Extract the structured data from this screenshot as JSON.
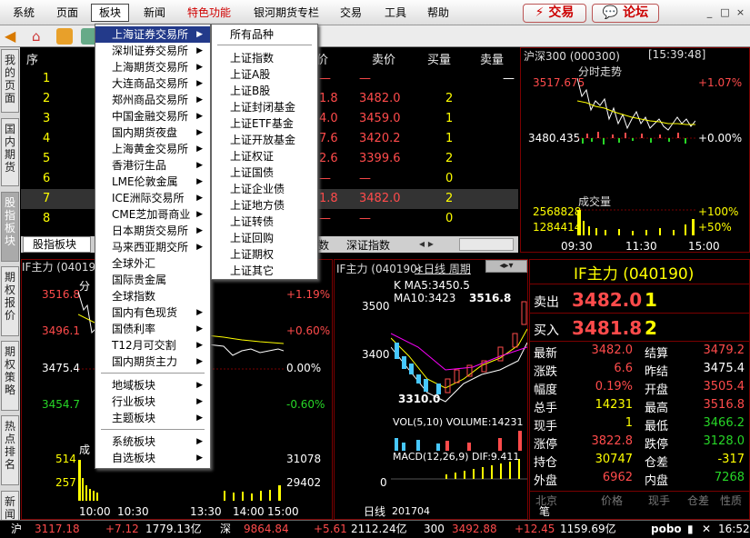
{
  "menubar": {
    "items": [
      "系统",
      "页面",
      "板块",
      "新闻",
      "特色功能",
      "银河期货专栏",
      "交易",
      "工具",
      "帮助"
    ],
    "trade": "交易",
    "forum": "论坛",
    "min": "_",
    "max": "□",
    "close": "×"
  },
  "sidebar": {
    "tabs": [
      "我的页面",
      "国内期货",
      "股指板块",
      "期权报价",
      "期权策略",
      "热点排名",
      "新闻"
    ]
  },
  "quote_table": {
    "headers": [
      "序",
      "价",
      "卖价",
      "买量",
      "卖量"
    ],
    "rows": [
      {
        "idx": "1",
        "price": "—",
        "ask": "—",
        "bidv": "",
        "askv": "—"
      },
      {
        "idx": "2",
        "price": "1.8",
        "ask": "3482.0",
        "bidv": "2",
        "askv": ""
      },
      {
        "idx": "3",
        "price": "4.0",
        "ask": "3459.0",
        "bidv": "1",
        "askv": ""
      },
      {
        "idx": "4",
        "price": "7.6",
        "ask": "3420.2",
        "bidv": "1",
        "askv": ""
      },
      {
        "idx": "5",
        "price": "2.6",
        "ask": "3399.6",
        "bidv": "2",
        "askv": ""
      },
      {
        "idx": "6",
        "price": "—",
        "ask": "—",
        "bidv": "0",
        "askv": ""
      },
      {
        "idx": "7",
        "price": "1.8",
        "ask": "3482.0",
        "bidv": "2",
        "askv": ""
      },
      {
        "idx": "8",
        "price": "—",
        "ask": "—",
        "bidv": "0",
        "askv": ""
      }
    ],
    "tab_active": "股指板块",
    "tab2": "数",
    "tab3": "深证指数"
  },
  "index_chart": {
    "title": "沪深300 (000300)",
    "time": "[15:39:48]",
    "label": "分时走势",
    "high": "3517.675",
    "mid": "3480.435",
    "pct_high": "+1.07%",
    "pct_mid": "+0.00%",
    "vol_label": "成交量",
    "vol_high": "2568828",
    "vol_mid": "1284414",
    "vol_pct_high": "+100%",
    "vol_pct_mid": "+50%",
    "times": [
      "09:30",
      "11:30",
      "15:00"
    ]
  },
  "if_left": {
    "title": "IF主力 (040190)",
    "p1": "3516.8",
    "p2": "3496.1",
    "p3": "3475.4",
    "p4": "3454.7",
    "pc1": "+1.19%",
    "pc2": "+0.60%",
    "pc3": "0.00%",
    "pc4": "-0.60%",
    "fen": "分",
    "cheng": "成",
    "v1": "514",
    "v2": "257",
    "v3": "31078",
    "v4": "29402",
    "times": [
      "10:00",
      "10:30",
      "13:30",
      "14:00",
      "15:00"
    ]
  },
  "if_kline": {
    "title": "IF主力 (040190)",
    "period": "<日线 周期",
    "ma": "K  MA5:3450.5  MA10:3423",
    "high": "3516.8",
    "low": "3310.0",
    "y1": "3500",
    "y2": "3400",
    "vol": "VOL(5,10)  VOLUME:14231",
    "macd": "MACD(12,26,9)  DIF:9.411",
    "zero": "0",
    "day": "日线",
    "date": "201704"
  },
  "if_quote": {
    "title": "IF主力 (040190)",
    "sell_label": "卖出",
    "sell_price": "3482.0",
    "sell_vol": "1",
    "buy_label": "买入",
    "buy_price": "3481.8",
    "buy_vol": "2",
    "rows": [
      [
        "最新",
        "3482.0",
        "结算",
        "3479.2"
      ],
      [
        "涨跌",
        "6.6",
        "昨结",
        "3475.4"
      ],
      [
        "幅度",
        "0.19%",
        "开盘",
        "3505.4"
      ],
      [
        "总手",
        "14231",
        "最高",
        "3516.8"
      ],
      [
        "现手",
        "1",
        "最低",
        "3466.2"
      ],
      [
        "涨停",
        "3822.8",
        "跌停",
        "3128.0"
      ],
      [
        "持仓",
        "30747",
        "仓差",
        "-317"
      ],
      [
        "外盘",
        "6962",
        "内盘",
        "7268"
      ]
    ],
    "bottom": [
      "北京",
      "价格",
      "现手",
      "仓差",
      "性质"
    ],
    "bi": "笔"
  },
  "dropdown": {
    "items": [
      "上海证券交易所",
      "深圳证券交易所",
      "上海期货交易所",
      "大连商品交易所",
      "郑州商品交易所",
      "中国金融交易所",
      "国内期货夜盘",
      "上海黄金交易所",
      "香港衍生品",
      "LME伦敦金属",
      "ICE洲际交易所",
      "CME芝加哥商业",
      "日本期货交易所",
      "马来西亚期交所",
      "全球外汇",
      "国际贵金属",
      "全球指数",
      "国内有色现货",
      "国债利率",
      "T12月可交割",
      "国内期货主力"
    ],
    "group2": [
      "地域板块",
      "行业板块",
      "主题板块"
    ],
    "group3": [
      "系统板块",
      "自选板块"
    ]
  },
  "submenu": {
    "items": [
      "所有品种",
      "上证指数",
      "上证A股",
      "上证B股",
      "上证封闭基金",
      "上证ETF基金",
      "上证开放基金",
      "上证权证",
      "上证国债",
      "上证企业债",
      "上证地方债",
      "上证转债",
      "上证回购",
      "上证期权",
      "上证其它"
    ]
  },
  "status": {
    "sh": "沪",
    "sh_val": "3117.18",
    "sh_chg": "+7.12",
    "sh_amt": "1779.13亿",
    "sz": "深",
    "sz_val": "9864.84",
    "sz_chg": "+5.61",
    "sz_amt": "2112.24亿",
    "i300": "300",
    "i300_val": "3492.88",
    "i300_chg": "+12.45",
    "i300_amt": "1159.69亿",
    "brand": "pobo",
    "clock": "16:52"
  }
}
